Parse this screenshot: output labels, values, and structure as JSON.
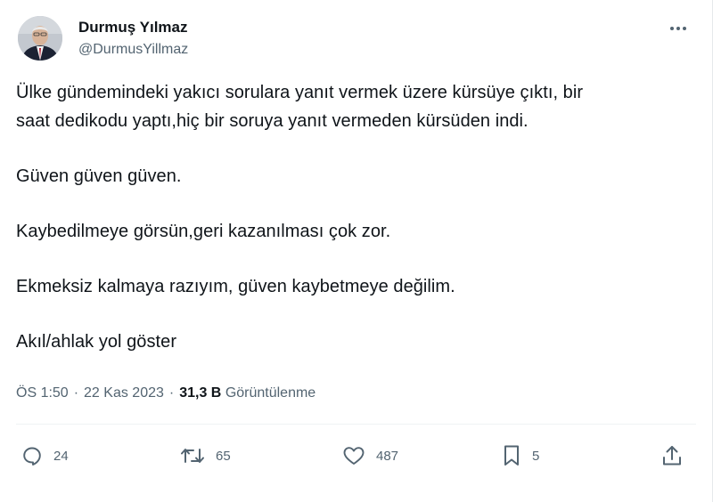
{
  "author": {
    "name": "Durmuş Yılmaz",
    "handle": "@DurmusYillmaz"
  },
  "tweet": {
    "paragraphs": [
      {
        "lines": [
          "Ülke gündemindeki yakıcı sorulara yanıt vermek üzere kürsüye çıktı, bir",
          "saat dedikodu yaptı,hiç bir soruya yanıt vermeden kürsüden indi."
        ]
      },
      {
        "lines": [
          "Güven güven güven."
        ]
      },
      {
        "lines": [
          "Kaybedilmeye görsün,geri kazanılması çok zor."
        ]
      },
      {
        "lines": [
          "Ekmeksiz kalmaya razıyım, güven kaybetmeye değilim."
        ]
      },
      {
        "lines": [
          "Akıl/ahlak yol göster"
        ]
      }
    ]
  },
  "meta": {
    "time": "ÖS 1:50",
    "separator": "·",
    "date": "22 Kas 2023",
    "views_count": "31,3 B",
    "views_label": "Görüntülenme"
  },
  "actions": {
    "replies": "24",
    "retweets": "65",
    "likes": "487",
    "bookmarks": "5"
  },
  "icons": [
    "more-icon",
    "reply-icon",
    "retweet-icon",
    "like-icon",
    "bookmark-icon",
    "share-icon"
  ],
  "colors": {
    "text": "#0f1419",
    "secondary": "#536471",
    "divider": "#eff3f4"
  }
}
